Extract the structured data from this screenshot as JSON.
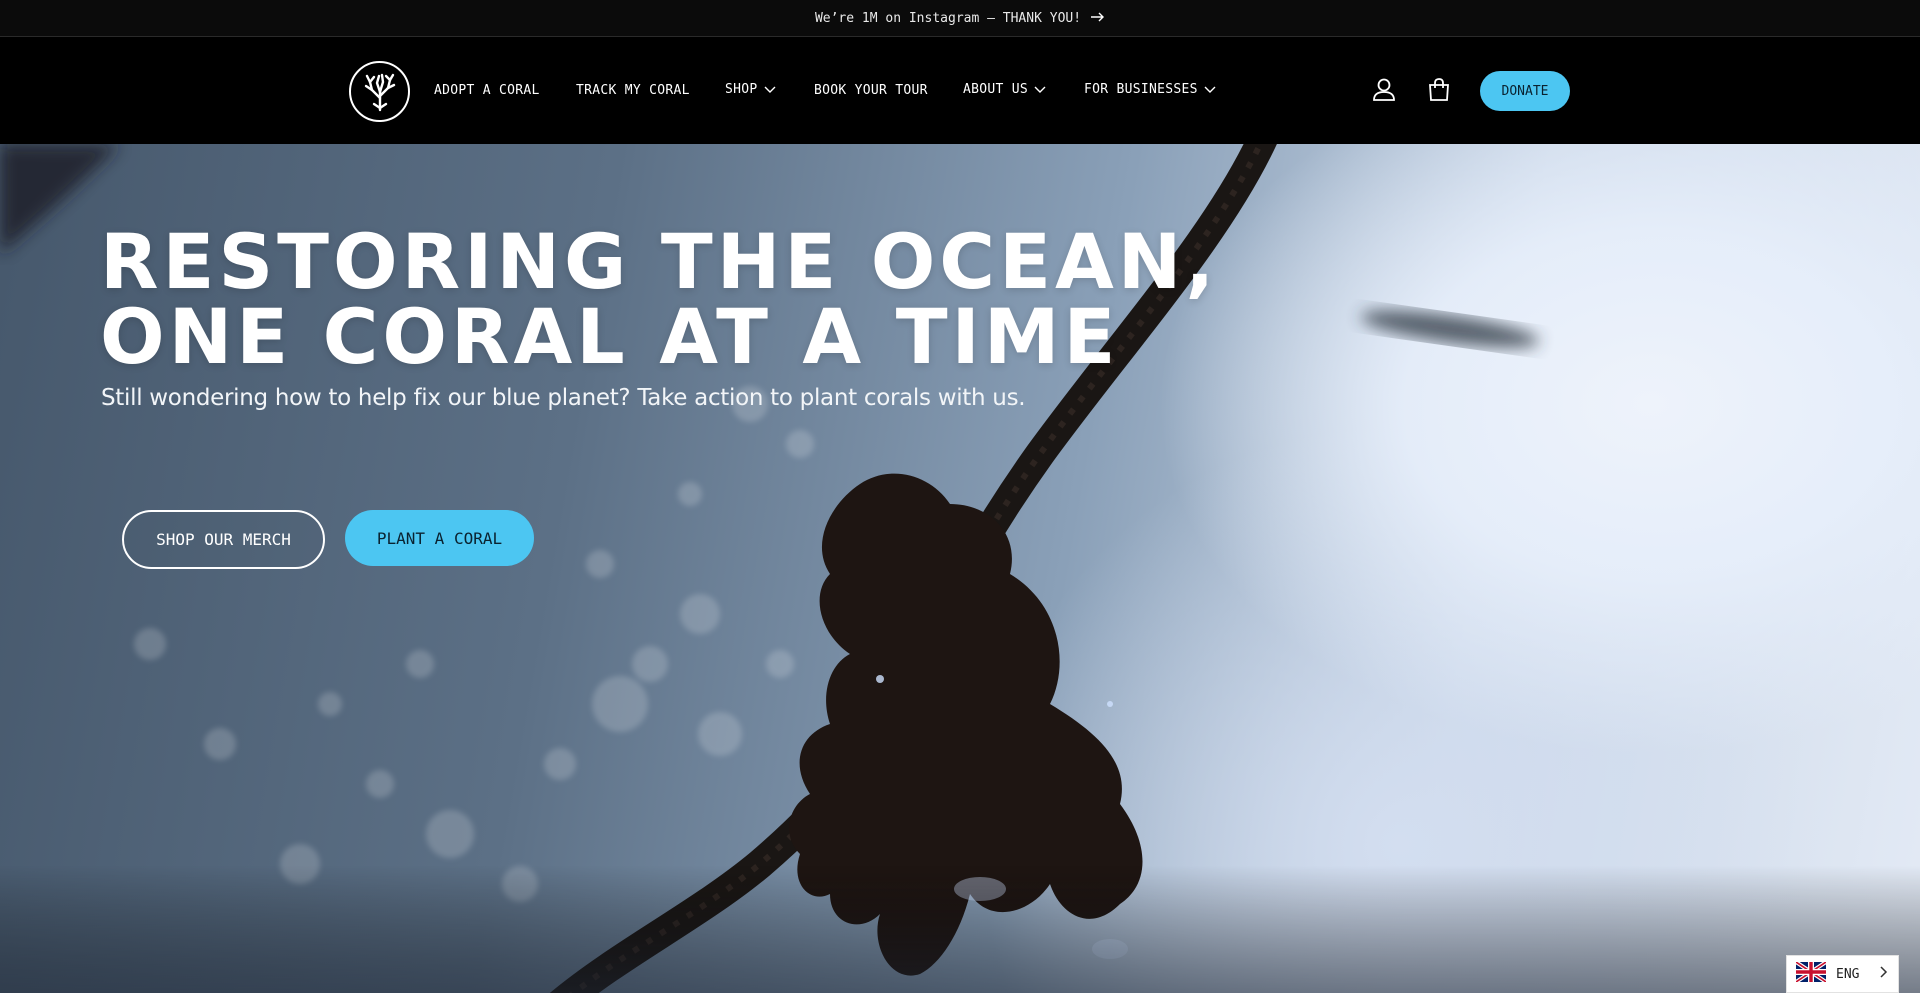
{
  "announcement": {
    "text": "We’re 1M on Instagram — THANK YOU!",
    "arrow_icon": "arrow-right-icon"
  },
  "header": {
    "logo_icon": "coral-logo-icon",
    "nav": [
      {
        "label": "ADOPT A CORAL",
        "has_dropdown": false
      },
      {
        "label": "TRACK MY CORAL",
        "has_dropdown": false
      },
      {
        "label": "SHOP",
        "has_dropdown": true
      },
      {
        "label": "BOOK YOUR TOUR",
        "has_dropdown": false
      },
      {
        "label": "ABOUT US",
        "has_dropdown": true
      },
      {
        "label": "FOR BUSINESSES",
        "has_dropdown": true
      }
    ],
    "account_icon": "user-icon",
    "cart_icon": "shopping-bag-icon",
    "donate_label": "DONATE"
  },
  "hero": {
    "title_line1": "RESTORING THE OCEAN,",
    "title_line2": "ONE CORAL AT A TIME",
    "subtitle": "Still wondering how to help fix our blue planet? Take action to plant corals with us.",
    "btn_merch": "SHOP OUR MERCH",
    "btn_plant": "PLANT A CORAL"
  },
  "language": {
    "label": "ENG",
    "flag_icon": "uk-flag-icon",
    "caret_icon": "chevron-right-icon"
  },
  "colors": {
    "accent": "#4cc6f2",
    "header_bg": "#000000"
  }
}
